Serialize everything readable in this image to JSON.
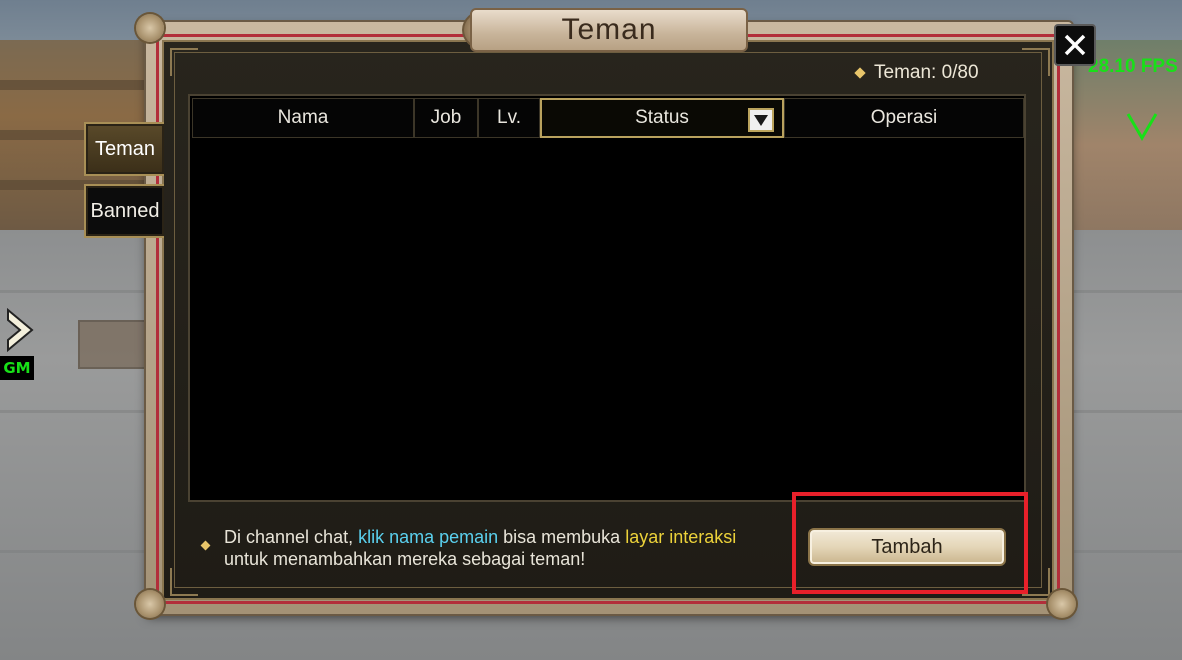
{
  "window": {
    "title": "Teman",
    "close_label": "X"
  },
  "hud": {
    "fps": "28.10 FPS",
    "gm_label": "GM"
  },
  "side_tabs": [
    {
      "label": "Teman",
      "active": true
    },
    {
      "label": "Banned",
      "active": false
    }
  ],
  "counter": {
    "label": "Teman: 0/80"
  },
  "table": {
    "columns": [
      "Nama",
      "Job",
      "Lv.",
      "Status",
      "Operasi"
    ],
    "rows": []
  },
  "hint": {
    "part1": "Di channel chat, ",
    "highlight1": "klik nama pemain",
    "part2": " bisa membuka ",
    "highlight2": "layar interaksi",
    "part3": "untuk menambahkan mereka sebagai teman!"
  },
  "actions": {
    "add_label": "Tambah"
  },
  "colors": {
    "fps": "#18e018",
    "highlight_box": "#e8202a",
    "hint_cyan": "#5ad0ee",
    "hint_yellow": "#ecd23a"
  }
}
